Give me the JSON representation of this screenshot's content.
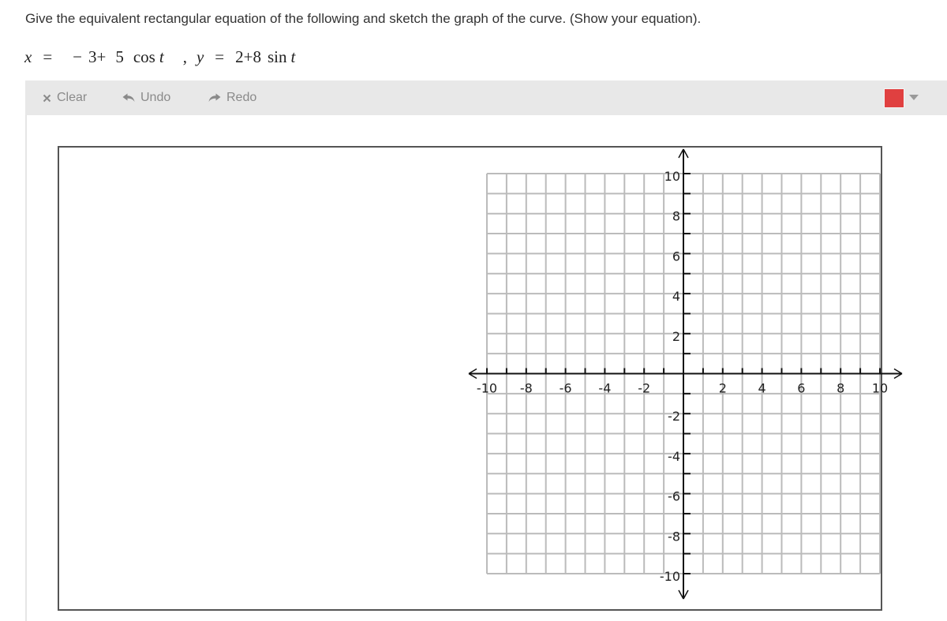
{
  "question": {
    "text": "Give the equivalent rectangular equation of the following and sketch the graph of the curve. (Show your equation)."
  },
  "equation": {
    "x_var": "x",
    "x_eq": "=",
    "x_expr_sign": "−",
    "x_expr_a": "3",
    "x_expr_plus": "+",
    "x_expr_b": "5",
    "x_expr_fn": "cos",
    "x_expr_t": "t",
    "sep": ",",
    "y_var": "y",
    "y_eq": "=",
    "y_expr_a": "2",
    "y_expr_plus": "+",
    "y_expr_b": "8",
    "y_expr_fn": "sin",
    "y_expr_t": "t"
  },
  "toolbar": {
    "clear_label": "Clear",
    "undo_label": "Undo",
    "redo_label": "Redo",
    "selected_color": "#e04040"
  },
  "chart_data": {
    "type": "graph-paper",
    "title": "",
    "xlabel": "",
    "ylabel": "",
    "xlim": [
      -10,
      10
    ],
    "ylim": [
      -10,
      10
    ],
    "grid": true,
    "grid_step": 1,
    "tick_step": 1,
    "label_step": 2,
    "x_tick_labels": [
      "-10",
      "-8",
      "-6",
      "-4",
      "-2",
      "2",
      "4",
      "6",
      "8",
      "10"
    ],
    "y_tick_labels": [
      "10",
      "8",
      "6",
      "4",
      "2",
      "-2",
      "-4",
      "-6",
      "-8",
      "-10"
    ],
    "series": [],
    "colors": {
      "grid": "#bbbbbb",
      "axis": "#111111"
    }
  }
}
